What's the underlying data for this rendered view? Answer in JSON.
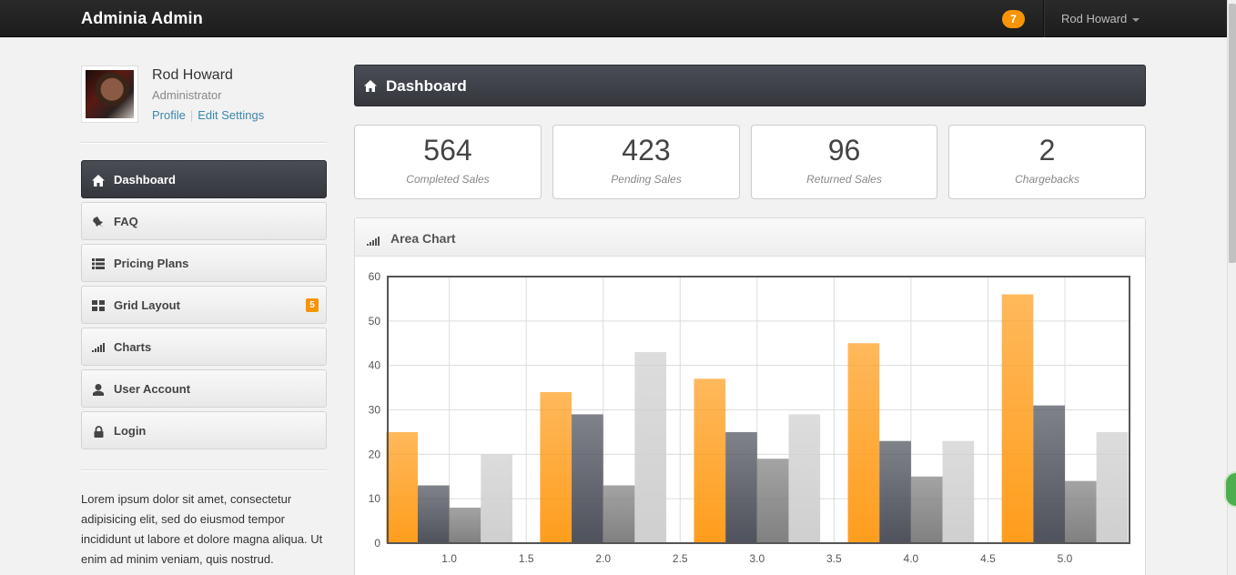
{
  "app": {
    "brand": "Adminia Admin"
  },
  "topbar": {
    "notification_count": "7",
    "user_name": "Rod Howard"
  },
  "profile": {
    "name": "Rod Howard",
    "role": "Administrator",
    "link_profile": "Profile",
    "link_settings": "Edit Settings"
  },
  "sidebar": {
    "items": [
      {
        "label": "Dashboard",
        "icon": "home-icon",
        "active": true
      },
      {
        "label": "FAQ",
        "icon": "pushpin-icon"
      },
      {
        "label": "Pricing Plans",
        "icon": "list-icon"
      },
      {
        "label": "Grid Layout",
        "icon": "grid-icon",
        "badge": "5"
      },
      {
        "label": "Charts",
        "icon": "signal-icon"
      },
      {
        "label": "User Account",
        "icon": "user-icon"
      },
      {
        "label": "Login",
        "icon": "lock-icon"
      }
    ],
    "lorem": "Lorem ipsum dolor sit amet, consectetur adipisicing elit, sed do eiusmod tempor incididunt ut labore et dolore magna aliqua. Ut enim ad minim veniam, quis nostrud."
  },
  "main": {
    "header_title": "Dashboard",
    "stats": [
      {
        "value": "564",
        "label": "Completed Sales"
      },
      {
        "value": "423",
        "label": "Pending Sales"
      },
      {
        "value": "96",
        "label": "Returned Sales"
      },
      {
        "value": "2",
        "label": "Chargebacks"
      }
    ],
    "panel_title": "Area Chart"
  },
  "colors": {
    "accent": "#f89406",
    "dark": "#35373d"
  },
  "chart_data": {
    "type": "bar",
    "title": "",
    "xlabel": "",
    "ylabel": "",
    "ylim": [
      0,
      60
    ],
    "yticks": [
      0,
      10,
      20,
      30,
      40,
      50,
      60
    ],
    "xticks": [
      "1.0",
      "1.5",
      "2.0",
      "2.5",
      "3.0",
      "3.5",
      "4.0",
      "4.5",
      "5.0"
    ],
    "categories": [
      1,
      2,
      3,
      4,
      5
    ],
    "grid": true,
    "series": [
      {
        "values": [
          25,
          34,
          37,
          45,
          56
        ],
        "color": "#ff9d1c"
      },
      {
        "values": [
          13,
          29,
          25,
          23,
          31
        ],
        "color": "#4f525c"
      },
      {
        "values": [
          8,
          13,
          19,
          15,
          14
        ],
        "color": "#808080"
      },
      {
        "values": [
          20,
          43,
          29,
          23,
          25
        ],
        "color": "#cfcfcf"
      }
    ]
  }
}
